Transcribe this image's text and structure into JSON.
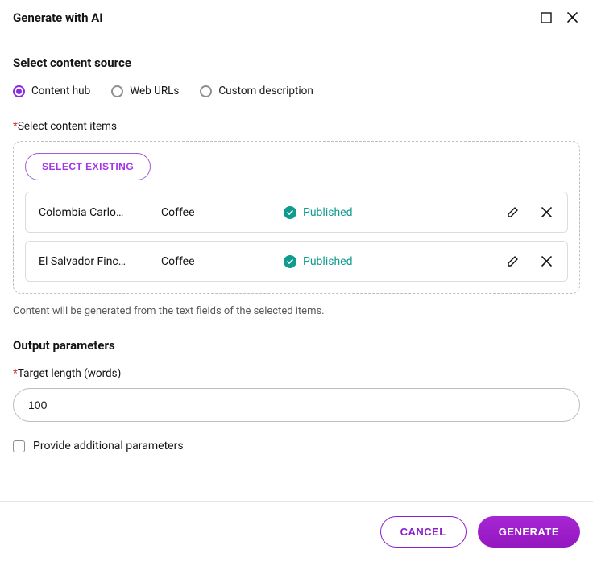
{
  "header": {
    "title": "Generate with AI"
  },
  "source": {
    "section_title": "Select content source",
    "options": [
      {
        "label": "Content hub",
        "selected": true
      },
      {
        "label": "Web URLs",
        "selected": false
      },
      {
        "label": "Custom description",
        "selected": false
      }
    ],
    "items_label": "Select content items",
    "select_existing_label": "SELECT EXISTING",
    "items": [
      {
        "name": "Colombia Carlo…",
        "type": "Coffee",
        "status": "Published"
      },
      {
        "name": "El Salvador Finc…",
        "type": "Coffee",
        "status": "Published"
      }
    ],
    "helper": "Content will be generated from the text fields of the selected items."
  },
  "output": {
    "section_title": "Output parameters",
    "target_length_label": "Target length (words)",
    "target_length_value": "100",
    "provide_additional_label": "Provide additional parameters",
    "provide_additional_checked": false
  },
  "footer": {
    "cancel": "CANCEL",
    "generate": "GENERATE"
  },
  "colors": {
    "accent": "#8a2be2",
    "status_ok": "#0f9b8e",
    "required": "#d62828"
  }
}
